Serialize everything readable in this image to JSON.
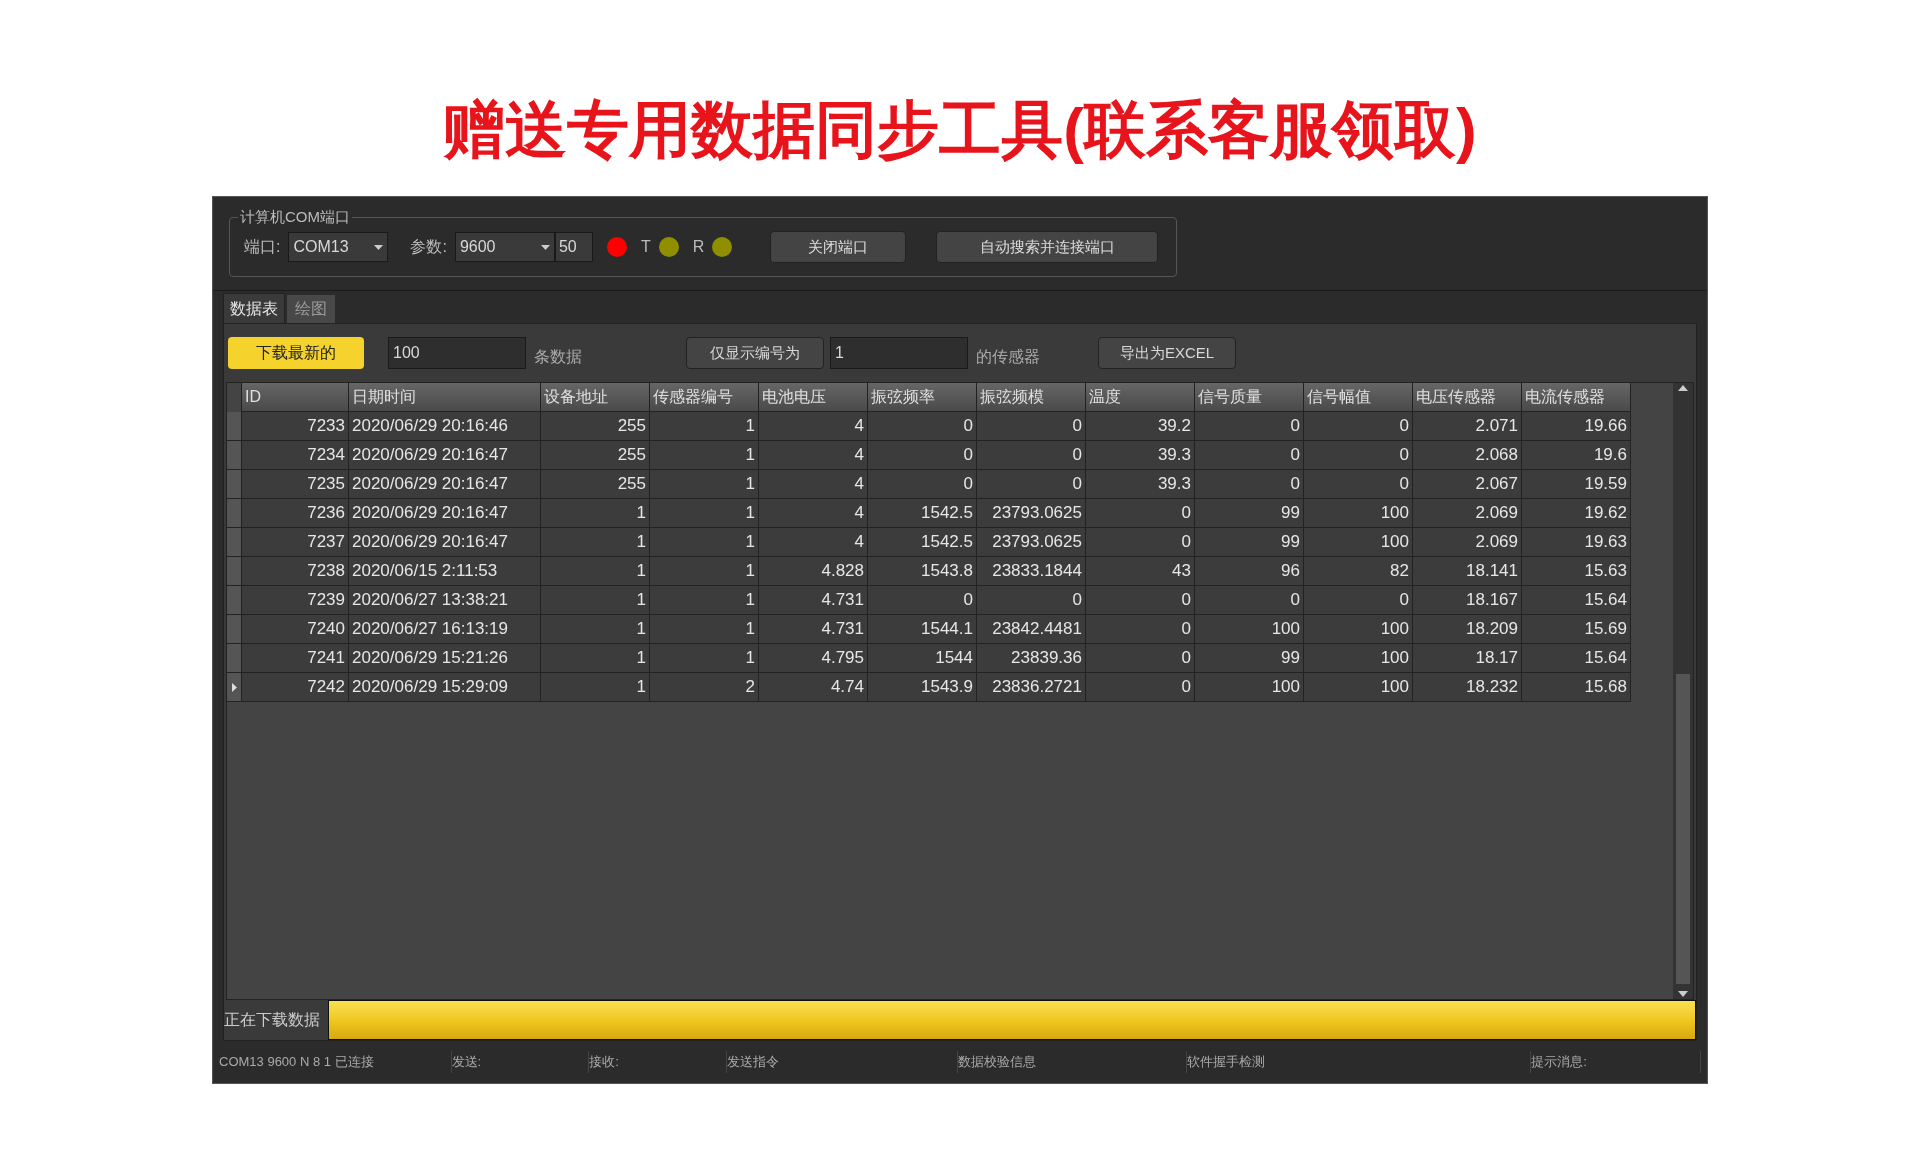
{
  "heading": "赠送专用数据同步工具(联系客服领取)",
  "com_group": {
    "title": "计算机COM端口",
    "port_label": "端口:",
    "port": "COM13",
    "param_label": "参数:",
    "baud": "9600",
    "timeout": "50",
    "leds": [
      {
        "color": "#ff0000"
      },
      {
        "label": "T",
        "color": "#8f8f00"
      },
      {
        "label": "R",
        "color": "#8f8f00"
      }
    ],
    "buttons": [
      "关闭端口",
      "自动搜索并连接端口"
    ]
  },
  "tabs": [
    {
      "label": "数据表",
      "selected": true
    },
    {
      "label": "绘图",
      "selected": false
    }
  ],
  "toolbar": {
    "download_button": "下载最新的",
    "count": "100",
    "count_suffix": "条数据",
    "filter_button": "仅显示编号为",
    "sensor_id": "1",
    "sensor_suffix": "的传感器",
    "export_button": "导出为EXCEL"
  },
  "table": {
    "columns": [
      "ID",
      "日期时间",
      "设备地址",
      "传感器编号",
      "电池电压",
      "振弦频率",
      "振弦频模",
      "温度",
      "信号质量",
      "信号幅值",
      "电压传感器",
      "电流传感器"
    ],
    "rows": [
      {
        "current": false,
        "cells": [
          "7233",
          "2020/06/29 20:16:46",
          "255",
          "1",
          "4",
          "0",
          "0",
          "39.2",
          "0",
          "0",
          "2.071",
          "19.66"
        ]
      },
      {
        "current": false,
        "cells": [
          "7234",
          "2020/06/29 20:16:47",
          "255",
          "1",
          "4",
          "0",
          "0",
          "39.3",
          "0",
          "0",
          "2.068",
          "19.6"
        ]
      },
      {
        "current": false,
        "cells": [
          "7235",
          "2020/06/29 20:16:47",
          "255",
          "1",
          "4",
          "0",
          "0",
          "39.3",
          "0",
          "0",
          "2.067",
          "19.59"
        ]
      },
      {
        "current": false,
        "cells": [
          "7236",
          "2020/06/29 20:16:47",
          "1",
          "1",
          "4",
          "1542.5",
          "23793.0625",
          "0",
          "99",
          "100",
          "2.069",
          "19.62"
        ]
      },
      {
        "current": false,
        "cells": [
          "7237",
          "2020/06/29 20:16:47",
          "1",
          "1",
          "4",
          "1542.5",
          "23793.0625",
          "0",
          "99",
          "100",
          "2.069",
          "19.63"
        ]
      },
      {
        "current": false,
        "cells": [
          "7238",
          "2020/06/15 2:11:53",
          "1",
          "1",
          "4.828",
          "1543.8",
          "23833.1844",
          "43",
          "96",
          "82",
          "18.141",
          "15.63"
        ]
      },
      {
        "current": false,
        "cells": [
          "7239",
          "2020/06/27 13:38:21",
          "1",
          "1",
          "4.731",
          "0",
          "0",
          "0",
          "0",
          "0",
          "18.167",
          "15.64"
        ]
      },
      {
        "current": false,
        "cells": [
          "7240",
          "2020/06/27 16:13:19",
          "1",
          "1",
          "4.731",
          "1544.1",
          "23842.4481",
          "0",
          "100",
          "100",
          "18.209",
          "15.69"
        ]
      },
      {
        "current": false,
        "cells": [
          "7241",
          "2020/06/29 15:21:26",
          "1",
          "1",
          "4.795",
          "1544",
          "23839.36",
          "0",
          "99",
          "100",
          "18.17",
          "15.64"
        ]
      },
      {
        "current": true,
        "cells": [
          "7242",
          "2020/06/29 15:29:09",
          "1",
          "2",
          "4.74",
          "1543.9",
          "23836.2721",
          "0",
          "100",
          "100",
          "18.232",
          "15.68"
        ]
      }
    ]
  },
  "progress": {
    "label": "正在下载数据",
    "level": 1
  },
  "status_bar": [
    "COM13 9600 N 8 1 已连接",
    "发送:",
    "接收:",
    "发送指令",
    "数据校验信息",
    "软件握手检测",
    "提示消息:"
  ]
}
